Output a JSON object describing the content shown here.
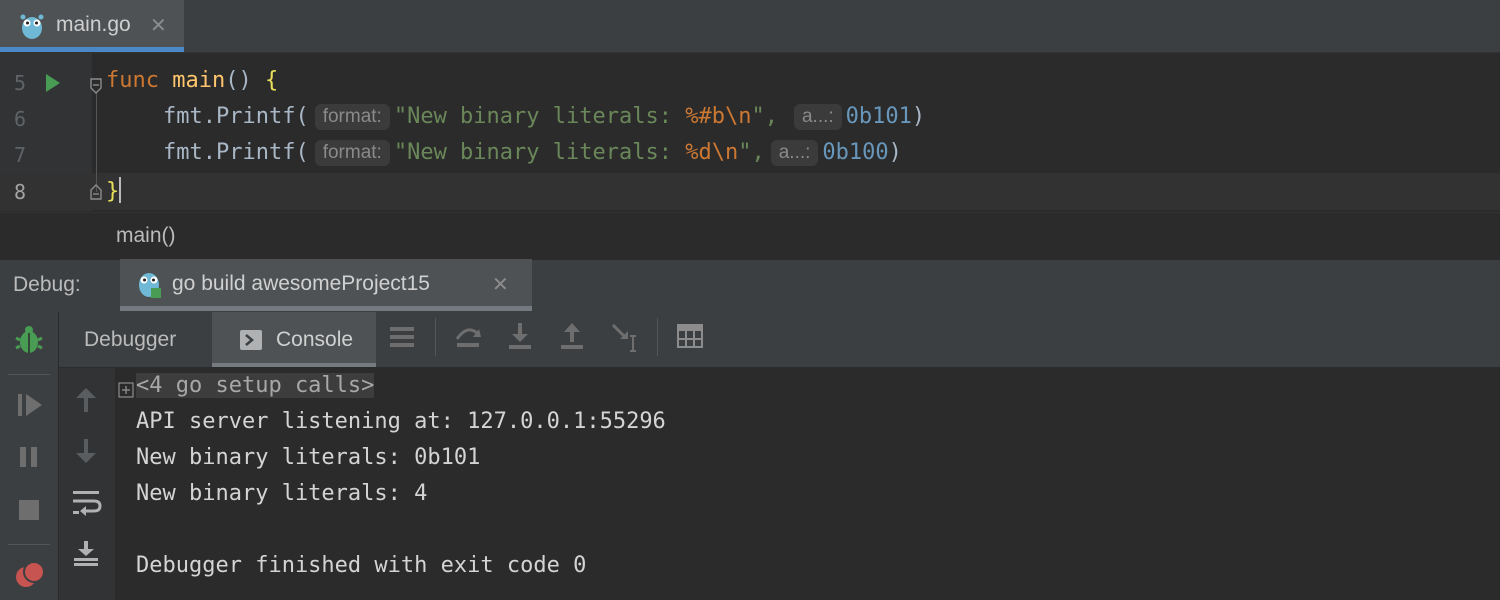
{
  "editor_tab": {
    "filename": "main.go",
    "close": "✕"
  },
  "editor": {
    "lines": [
      {
        "number": "5"
      },
      {
        "number": "6"
      },
      {
        "number": "7"
      },
      {
        "number": "8"
      }
    ],
    "code": {
      "l5_kw": "func",
      "l5_fn": "main",
      "l5_rest": "() ",
      "l5_brace": "{",
      "l6_call": "fmt.Printf(",
      "l6_hint1": "format:",
      "l6_str1": "\"New binary literals: ",
      "l6_esc": "%#b\\n",
      "l6_str2": "\",",
      "l6_hint2": "a...:",
      "l6_num": "0b101",
      "l6_end": ")",
      "l7_call": "fmt.Printf(",
      "l7_hint1": "format:",
      "l7_str1": "\"New binary literals: ",
      "l7_esc": "%d\\n",
      "l7_str2": "\",",
      "l7_hint2": "a...:",
      "l7_num": "0b100",
      "l7_end": ")",
      "l8_brace": "}"
    }
  },
  "breadcrumb": "main()",
  "debug": {
    "label": "Debug:",
    "run_tab": "go build awesomeProject15",
    "close": "✕",
    "tabs": {
      "debugger": "Debugger",
      "console": "Console"
    }
  },
  "console": {
    "setup_calls": "<4 go setup calls>",
    "lines": [
      "API server listening at: 127.0.0.1:55296",
      "New binary literals: 0b101",
      "New binary literals: 4",
      "",
      "Debugger finished with exit code 0"
    ]
  },
  "colors": {
    "accent": "#4a88c7",
    "run_green": "#499c54",
    "stop_red": "#c75450"
  }
}
